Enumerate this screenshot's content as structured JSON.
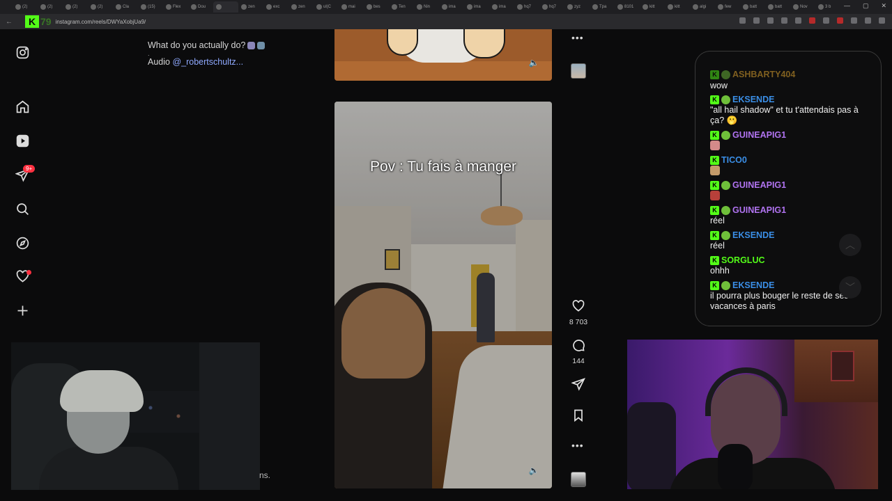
{
  "browser": {
    "tabs": [
      {
        "label": "(2)"
      },
      {
        "label": "(2)"
      },
      {
        "label": "(2)"
      },
      {
        "label": "(2)"
      },
      {
        "label": "Cla"
      },
      {
        "label": "(15)"
      },
      {
        "label": "Flex"
      },
      {
        "label": "Dou"
      },
      {
        "label": ""
      },
      {
        "label": "zen"
      },
      {
        "label": "exc"
      },
      {
        "label": "zen"
      },
      {
        "label": "ul(C"
      },
      {
        "label": "mai"
      },
      {
        "label": "bes"
      },
      {
        "label": "Ten"
      },
      {
        "label": "Nin"
      },
      {
        "label": "ima"
      },
      {
        "label": "ima"
      },
      {
        "label": "ima"
      },
      {
        "label": "hq7"
      },
      {
        "label": "hq7"
      },
      {
        "label": "zyz"
      },
      {
        "label": "Tpa"
      },
      {
        "label": "8101"
      },
      {
        "label": "kitt"
      },
      {
        "label": "kitt"
      },
      {
        "label": "algi"
      },
      {
        "label": "few"
      },
      {
        "label": "batt"
      },
      {
        "label": "batt"
      },
      {
        "label": "Nov"
      },
      {
        "label": "3 b"
      }
    ],
    "url": "instagram.com/reels/DWYaXobjUa9/",
    "stream_counter": "79"
  },
  "sidebar": {
    "notification_badge": "9+"
  },
  "post": {
    "caption": "What do you actually do?",
    "caption_dot": ".",
    "audio_prefix": "Audio",
    "audio_handle": "@_robertschultz..."
  },
  "reel": {
    "overlay_text": "Pov : Tu fais à manger",
    "likes": "8 703",
    "comments": "144"
  },
  "overlay": {
    "cut_text": "ns."
  },
  "chat": {
    "messages": [
      {
        "user": "ASHBARTY404",
        "text": "wow",
        "color": "#f0b030"
      },
      {
        "user": "EKSENDE",
        "text": "\"all hail shadow\" et tu t'attendais pas à ça? 🫢",
        "color": "#3a8ee6"
      },
      {
        "user": "GUINEAPIG1",
        "text": "",
        "color": "#b073f0"
      },
      {
        "user": "TICO0",
        "text": "",
        "color": "#3a8ee6"
      },
      {
        "user": "GUINEAPIG1",
        "text": "",
        "color": "#b073f0"
      },
      {
        "user": "GUINEAPIG1",
        "text": "réel",
        "color": "#b073f0"
      },
      {
        "user": "EKSENDE",
        "text": "réel",
        "color": "#3a8ee6"
      },
      {
        "user": "SORGLUC",
        "text": "ohhh",
        "color": "#53fc18"
      },
      {
        "user": "EKSENDE",
        "text": "il pourra plus bouger le reste de ses vacances à paris",
        "color": "#3a8ee6"
      }
    ]
  },
  "colors": {
    "kick_green": "#53fc18",
    "notification_red": "#ff3040",
    "link_blue": "#8fa9ff"
  }
}
